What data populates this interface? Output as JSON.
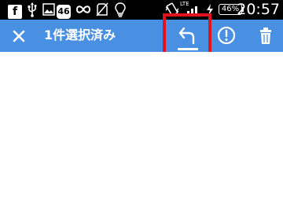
{
  "status_bar": {
    "badge_number": "46",
    "network_label": "LTE",
    "battery_percent": "46%",
    "time": "20:57",
    "icons": [
      "facebook-icon",
      "usb-icon",
      "image-icon",
      "badge-46-icon",
      "infinity-icon",
      "no-sim-icon",
      "bulb-icon",
      "vibrate-icon",
      "signal-icon",
      "charging-icon",
      "battery-icon"
    ]
  },
  "action_bar": {
    "title": "1件選択済み",
    "background_color": "#4a90e2",
    "actions": [
      "close-icon",
      "reply-icon",
      "alert-icon",
      "trash-icon"
    ]
  },
  "highlight": {
    "color": "#e2131d",
    "target": "reply-button"
  }
}
